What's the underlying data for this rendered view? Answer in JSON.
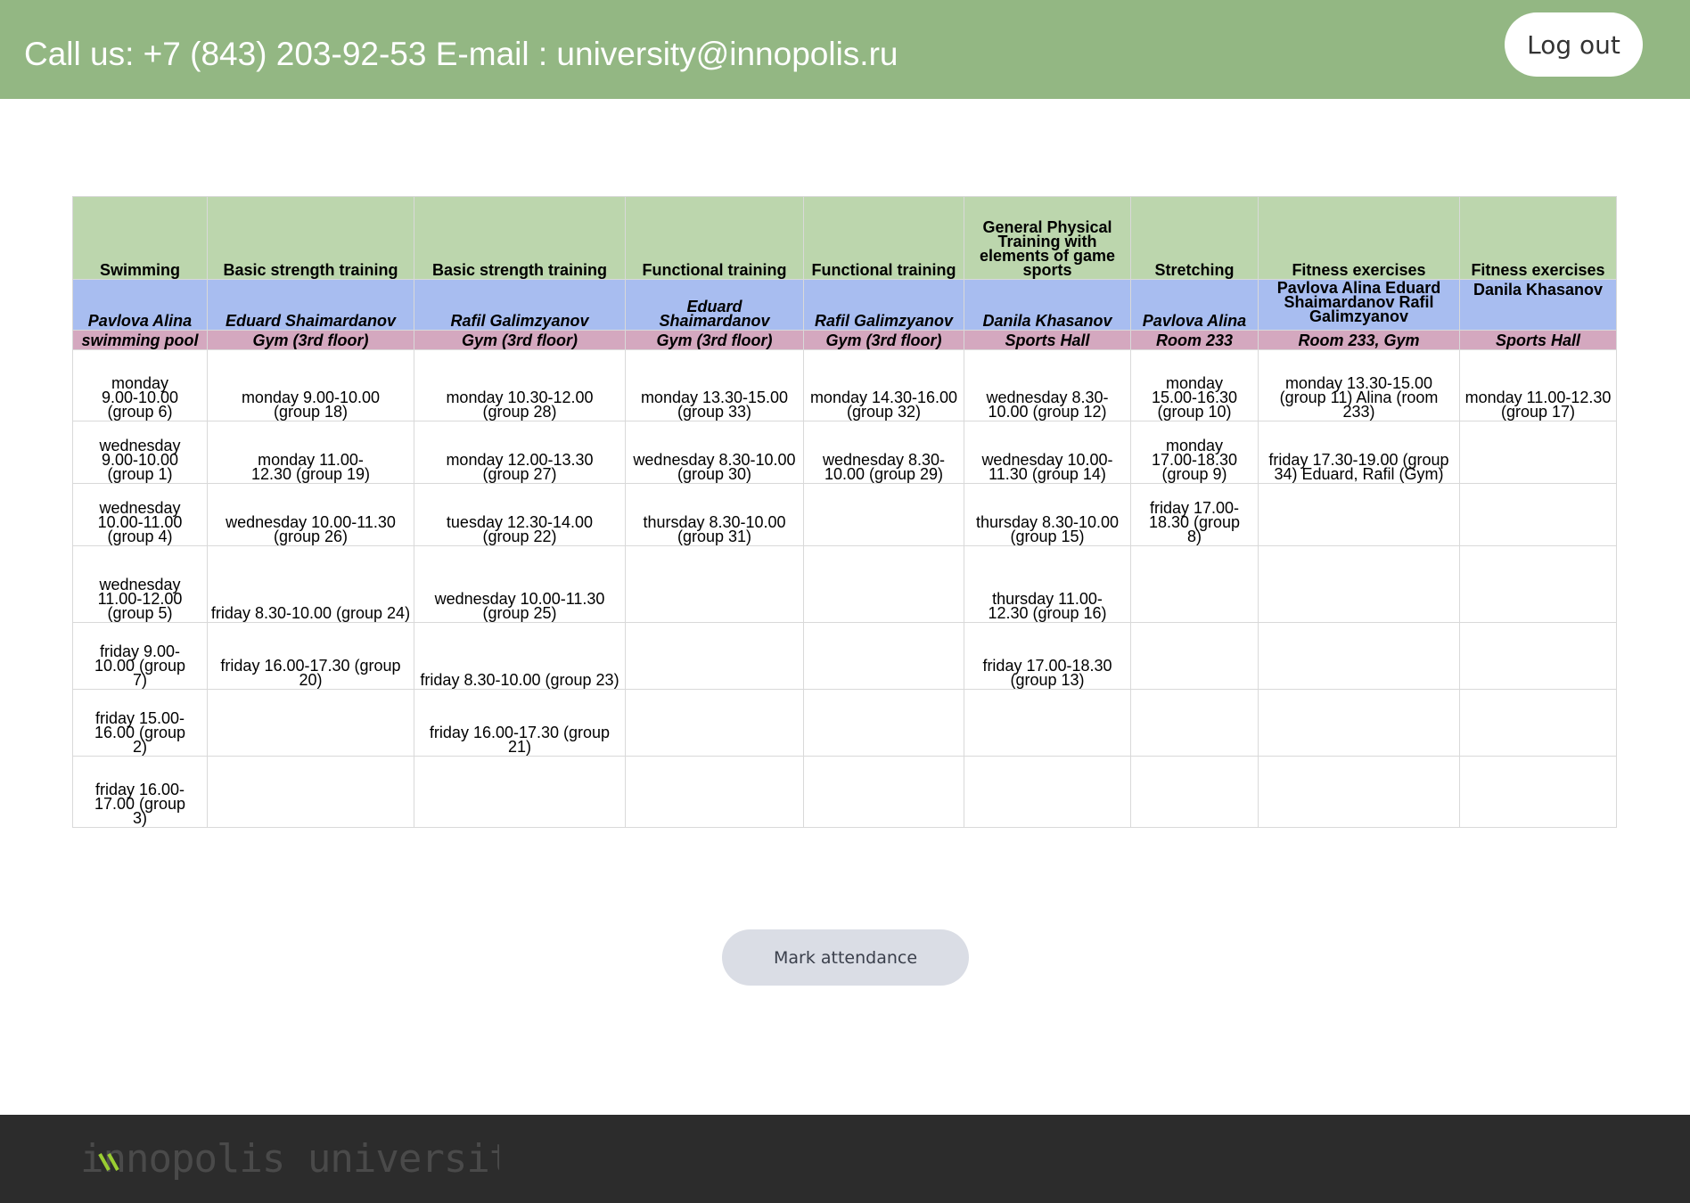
{
  "header": {
    "contact": "Call us: +7 (843) 203-92-53 E-mail : university@innopolis.ru",
    "logout_label": "Log out"
  },
  "schedule": {
    "columns": [
      {
        "title": "Swimming",
        "coach": "Pavlova Alina",
        "room": "swimming pool"
      },
      {
        "title": "Basic strength training",
        "coach": "Eduard Shaimardanov",
        "room": "Gym (3rd floor)"
      },
      {
        "title": "Basic strength training",
        "coach": "Rafil Galimzyanov",
        "room": "Gym (3rd floor)"
      },
      {
        "title": "Functional training",
        "coach": "Eduard Shaimardanov",
        "room": "Gym (3rd floor)"
      },
      {
        "title": "Functional training",
        "coach": "Rafil Galimzyanov",
        "room": "Gym (3rd floor)"
      },
      {
        "title": "General Physical Training with elements of game sports",
        "coach": "Danila Khasanov",
        "room": "Sports Hall"
      },
      {
        "title": "Stretching",
        "coach": "Pavlova Alina",
        "room": "Room 233"
      },
      {
        "title": "Fitness exercises",
        "coach": "Pavlova Alina Eduard Shaimardanov Rafil Galimzyanov",
        "room": "Room 233, Gym"
      },
      {
        "title": "Fitness exercises",
        "coach": "Danila Khasanov",
        "room": "Sports Hall"
      }
    ],
    "rows": [
      [
        "monday 9.00-10.00 (group 6)",
        "monday 9.00-10.00 (group 18)",
        "monday 10.30-12.00 (group 28)",
        "monday 13.30-15.00 (group 33)",
        "monday 14.30-16.00 (group 32)",
        "wednesday 8.30-10.00 (group 12)",
        "monday 15.00-16.30 (group 10)",
        "monday 13.30-15.00 (group 11) Alina (room 233)",
        "monday 11.00-12.30 (group 17)"
      ],
      [
        "wednesday 9.00-10.00 (group 1)",
        "monday 11.00-12.30 (group 19)",
        "monday 12.00-13.30 (group 27)",
        "wednesday 8.30-10.00 (group 30)",
        "wednesday 8.30-10.00 (group 29)",
        "wednesday 10.00-11.30 (group 14)",
        "monday 17.00-18.30 (group 9)",
        "friday 17.30-19.00 (group 34) Eduard, Rafil (Gym)",
        ""
      ],
      [
        "wednesday 10.00-11.00 (group 4)",
        "wednesday 10.00-11.30 (group 26)",
        "tuesday 12.30-14.00 (group 22)",
        "thursday 8.30-10.00 (group 31)",
        "",
        "thursday 8.30-10.00 (group 15)",
        "friday 17.00-18.30 (group 8)",
        "",
        ""
      ],
      [
        "wednesday 11.00-12.00 (group 5)",
        "friday 8.30-10.00 (group 24)",
        "wednesday 10.00-11.30 (group 25)",
        "",
        "",
        "thursday 11.00-12.30 (group 16)",
        "",
        "",
        ""
      ],
      [
        "friday 9.00-10.00 (group 7)",
        "friday 16.00-17.30 (group 20)",
        "friday 8.30-10.00 (group 23)",
        "",
        "",
        "friday 17.00-18.30 (group 13)",
        "",
        "",
        ""
      ],
      [
        "friday 15.00-16.00 (group 2)",
        "",
        "friday 16.00-17.30 (group 21)",
        "",
        "",
        "",
        "",
        "",
        ""
      ],
      [
        "friday 16.00-17.00 (group 3)",
        "",
        "",
        "",
        "",
        "",
        "",
        "",
        ""
      ]
    ]
  },
  "mark_attendance_label": "Mark attendance",
  "footer": {
    "logo_text": "innopolis university",
    "logo_color": "#4a4a4a",
    "logo_accent": "#9acd32"
  }
}
